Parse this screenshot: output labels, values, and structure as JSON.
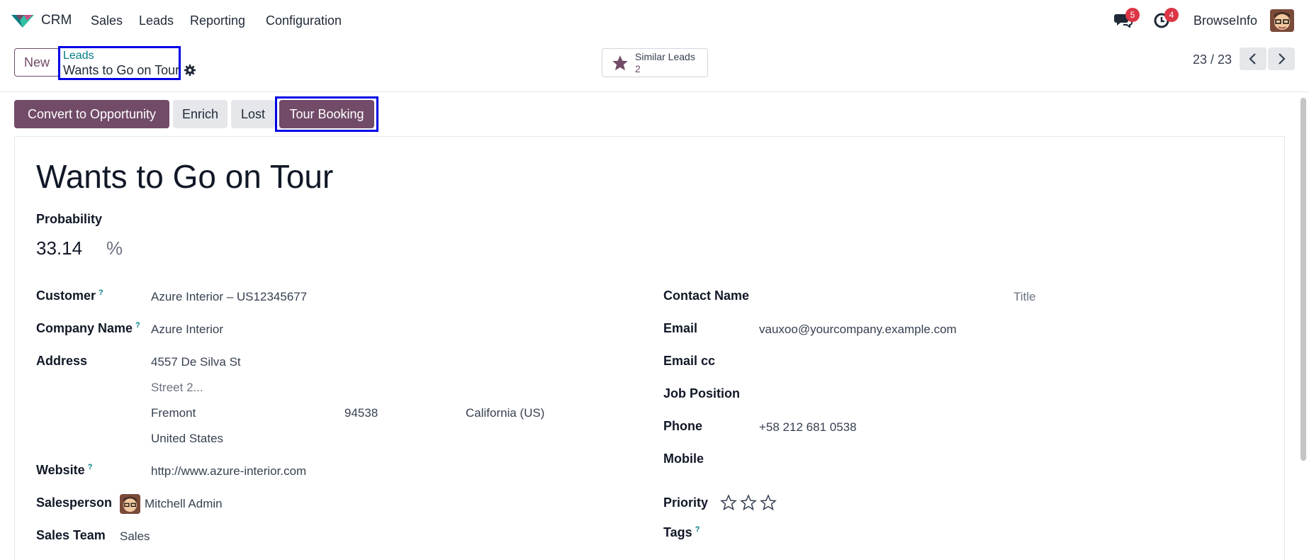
{
  "nav": {
    "app": "CRM",
    "menu": [
      "Sales",
      "Leads",
      "Reporting",
      "Configuration"
    ],
    "messages_count": "5",
    "activities_count": "4",
    "company": "BrowseInfo"
  },
  "control_panel": {
    "new_label": "New",
    "breadcrumb_parent": "Leads",
    "breadcrumb_current": "Wants to Go on Tour",
    "similar_label": "Similar Leads",
    "similar_count": "2",
    "pager": "23 / 23"
  },
  "status_buttons": {
    "convert": "Convert to Opportunity",
    "enrich": "Enrich",
    "lost": "Lost",
    "tour": "Tour Booking"
  },
  "form": {
    "title": "Wants to Go on Tour",
    "probability_label": "Probability",
    "probability_value": "33.14",
    "probability_unit": "%",
    "left": {
      "customer_label": "Customer",
      "customer_value": "Azure Interior – US12345677",
      "company_label": "Company Name",
      "company_value": "Azure Interior",
      "address_label": "Address",
      "street": "4557 De Silva St",
      "street2_placeholder": "Street 2...",
      "city": "Fremont",
      "zip": "94538",
      "state": "California (US)",
      "country": "United States",
      "website_label": "Website",
      "website_value": "http://www.azure-interior.com",
      "salesperson_label": "Salesperson",
      "salesperson_value": "Mitchell Admin",
      "team_label": "Sales Team",
      "team_value": "Sales"
    },
    "right": {
      "contact_label": "Contact Name",
      "title_placeholder": "Title",
      "email_label": "Email",
      "email_value": "vauxoo@yourcompany.example.com",
      "email_cc_label": "Email cc",
      "job_label": "Job Position",
      "phone_label": "Phone",
      "phone_value": "+58 212 681 0538",
      "mobile_label": "Mobile",
      "priority_label": "Priority",
      "priority_stars": 0,
      "tags_label": "Tags"
    },
    "help_mark": "?"
  },
  "colors": {
    "brand": "#714b67",
    "link": "#017e84",
    "highlight_frame": "#0000e6",
    "badge": "#dc3545"
  }
}
